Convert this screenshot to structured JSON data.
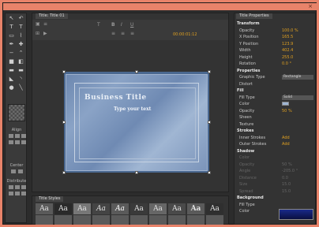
{
  "window": {
    "close_glyph": "×"
  },
  "main": {
    "tab_label": "Title: Title 01",
    "timecode": "00:00:01:12",
    "toolbar": {
      "t_label": "T",
      "b_label": "B",
      "i_label": "I",
      "u_label": "U"
    }
  },
  "canvas": {
    "title_text": "Business Title",
    "subtitle_text": "Type your text"
  },
  "tools": {
    "align_label": "Align",
    "center_label": "Center",
    "distribute_label": "Distribute"
  },
  "styles": {
    "tab_label": "Title Styles",
    "samples": [
      "Aa",
      "Aa",
      "Aa",
      "Aa",
      "Aa",
      "Aa",
      "Aa",
      "Aa",
      "Aa",
      "Aa"
    ]
  },
  "props": {
    "tab_label": "Title Properties",
    "rows": [
      {
        "k": "Transform",
        "v": "",
        "sec": true
      },
      {
        "k": "Opacity",
        "v": "100.0 %"
      },
      {
        "k": "X Position",
        "v": "165.5"
      },
      {
        "k": "Y Position",
        "v": "123.9"
      },
      {
        "k": "Width",
        "v": "402.4"
      },
      {
        "k": "Height",
        "v": "255.0"
      },
      {
        "k": "Rotation",
        "v": "0.0 °"
      },
      {
        "k": "Properties",
        "v": "",
        "sec": true
      },
      {
        "k": "Graphic Type",
        "v": "Rectangle"
      },
      {
        "k": "Distort",
        "v": ""
      },
      {
        "k": "Fill",
        "v": "",
        "sec": true
      },
      {
        "k": "Fill Type",
        "v": "Solid"
      },
      {
        "k": "Color",
        "v": ""
      },
      {
        "k": "Opacity",
        "v": "50 %"
      },
      {
        "k": "Sheen",
        "v": ""
      },
      {
        "k": "Texture",
        "v": ""
      },
      {
        "k": "Strokes",
        "v": "",
        "sec": true
      },
      {
        "k": "Inner Strokes",
        "v": "Add"
      },
      {
        "k": "Outer Strokes",
        "v": "Add"
      },
      {
        "k": "Shadow",
        "v": "",
        "sec": true
      },
      {
        "k": "Color",
        "v": "",
        "dim": true
      },
      {
        "k": "Opacity",
        "v": "50 %",
        "dim": true
      },
      {
        "k": "Angle",
        "v": "-205.0 °",
        "dim": true
      },
      {
        "k": "Distance",
        "v": "0.0",
        "dim": true
      },
      {
        "k": "Size",
        "v": "15.0",
        "dim": true
      },
      {
        "k": "Spread",
        "v": "15.0",
        "dim": true
      },
      {
        "k": "Background",
        "v": "",
        "sec": true
      },
      {
        "k": "Fill Type",
        "v": ""
      },
      {
        "k": "Color",
        "v": ""
      }
    ]
  },
  "colors": {
    "accent": "#e0a020",
    "frame": "#e8836a"
  }
}
